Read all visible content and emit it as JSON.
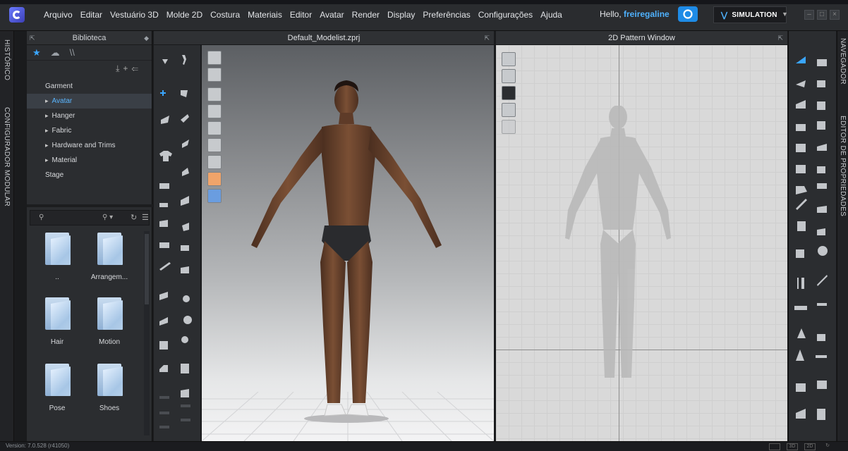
{
  "menu": {
    "items": [
      "Arquivo",
      "Editar",
      "Vestuário 3D",
      "Molde 2D",
      "Costura",
      "Materiais",
      "Editor",
      "Avatar",
      "Render",
      "Display",
      "Preferências",
      "Configurações",
      "Ajuda"
    ],
    "hello_prefix": "Hello, ",
    "username": "freiregaline",
    "simulation_label": "SIMULATION"
  },
  "side_tabs": {
    "left_top": "HISTÓRICO",
    "left_bottom": "CONFIGURADOR MODULAR",
    "right_top": "NAVEGADOR",
    "right_bottom": "EDITOR DE PROPRIEDADES"
  },
  "library": {
    "title": "Biblioteca",
    "tree": [
      {
        "label": "Garment",
        "expandable": false,
        "selected": false
      },
      {
        "label": "Avatar",
        "expandable": true,
        "selected": true
      },
      {
        "label": "Hanger",
        "expandable": true,
        "selected": false
      },
      {
        "label": "Fabric",
        "expandable": true,
        "selected": false
      },
      {
        "label": "Hardware and Trims",
        "expandable": true,
        "selected": false
      },
      {
        "label": "Material",
        "expandable": true,
        "selected": false
      },
      {
        "label": "Stage",
        "expandable": false,
        "selected": false
      }
    ],
    "folders": [
      "..",
      "Arrangem...",
      "Hair",
      "Motion",
      "Pose",
      "Shoes"
    ]
  },
  "viewport3d": {
    "title": "Default_Modelist.zprj"
  },
  "viewport2d": {
    "title": "2D Pattern Window"
  },
  "status": {
    "version": "Version: 7.0.528 (r41050)"
  },
  "colors": {
    "accent": "#3aa6ff",
    "selected_bg": "#3a3f46",
    "panel": "#2b2d30"
  }
}
